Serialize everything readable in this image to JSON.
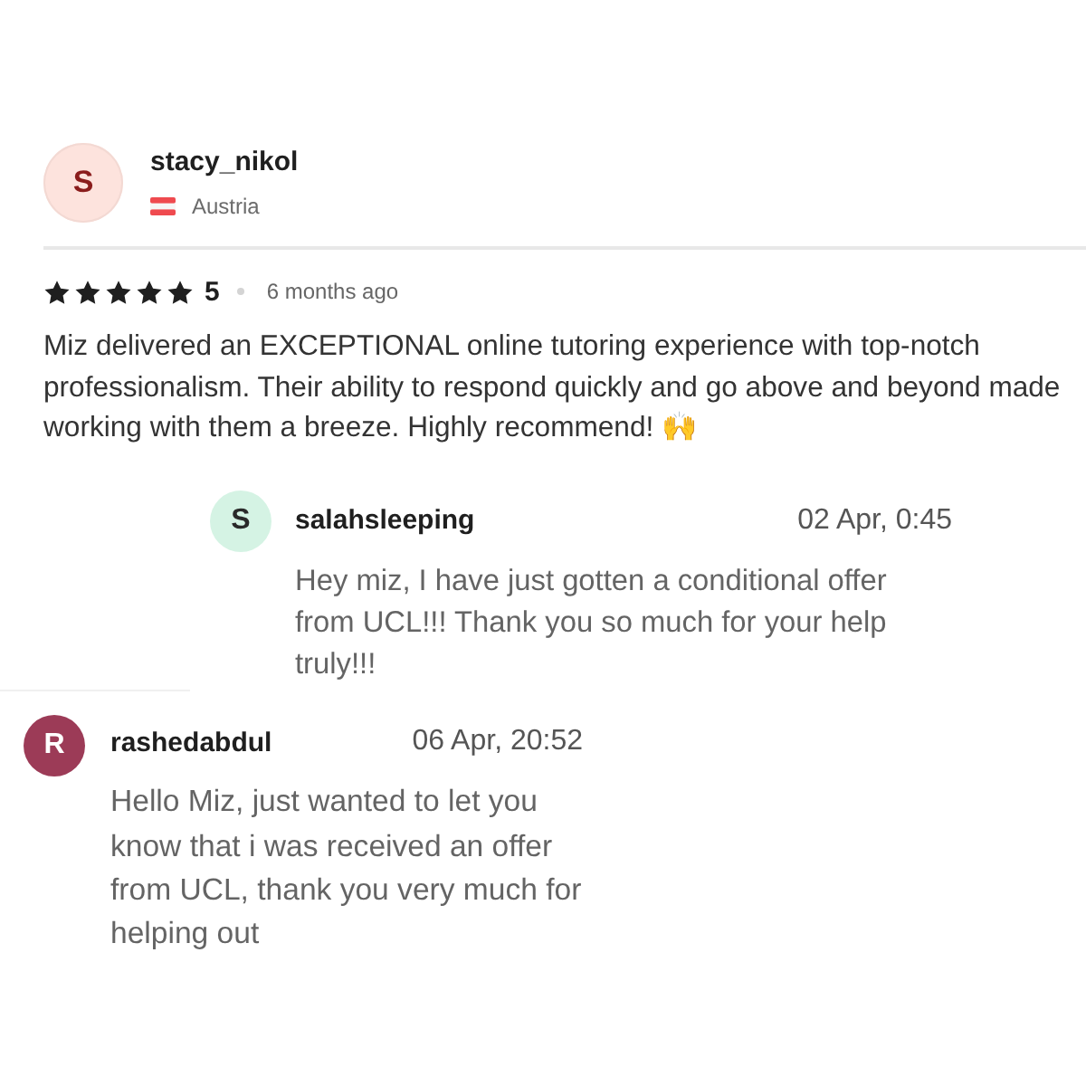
{
  "review": {
    "author": {
      "avatar_letter": "S",
      "name": "stacy_nikol",
      "country": "Austria"
    },
    "stars": 5,
    "rating": "5",
    "time": "6 months ago",
    "text": "Miz delivered an EXCEPTIONAL online tutoring experience with top-notch professionalism. Their ability to respond quickly and go above and beyond made working with them a breeze. Highly recommend! 🙌",
    "replies": [
      {
        "avatar_letter": "S",
        "color": "#d5f3e4",
        "name": "salahsleeping",
        "date": "02 Apr, 0:45",
        "text": "Hey miz, I have just gotten a conditional offer from UCL!!! Thank you so much for your help truly!!!"
      }
    ]
  },
  "messages": [
    {
      "avatar_letter": "R",
      "color": "#9c3b57",
      "name": "rashedabdul",
      "date": "06 Apr, 20:52",
      "text": "Hello Miz, just wanted to let you know that i was received an offer from UCL, thank you very much for helping out"
    }
  ]
}
